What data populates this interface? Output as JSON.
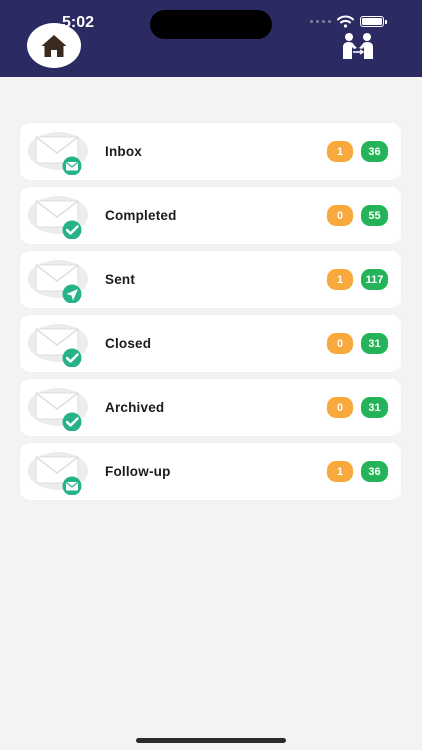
{
  "status_bar": {
    "time": "5:02"
  },
  "header": {
    "home_icon": "home-icon",
    "people_icon": "people-exchange-icon"
  },
  "colors": {
    "header": "#2b2a63",
    "badge_orange": "#f7a93b",
    "badge_green": "#25b35a",
    "overlay": "#26b38a"
  },
  "rows": [
    {
      "label": "Inbox",
      "pending": "1",
      "total": "36",
      "overlay_icon": "envelope-icon"
    },
    {
      "label": "Completed",
      "pending": "0",
      "total": "55",
      "overlay_icon": "check-icon"
    },
    {
      "label": "Sent",
      "pending": "1",
      "total": "117",
      "overlay_icon": "send-icon"
    },
    {
      "label": "Closed",
      "pending": "0",
      "total": "31",
      "overlay_icon": "check-icon"
    },
    {
      "label": "Archived",
      "pending": "0",
      "total": "31",
      "overlay_icon": "check-icon"
    },
    {
      "label": "Follow-up",
      "pending": "1",
      "total": "36",
      "overlay_icon": "envelope-icon"
    }
  ]
}
